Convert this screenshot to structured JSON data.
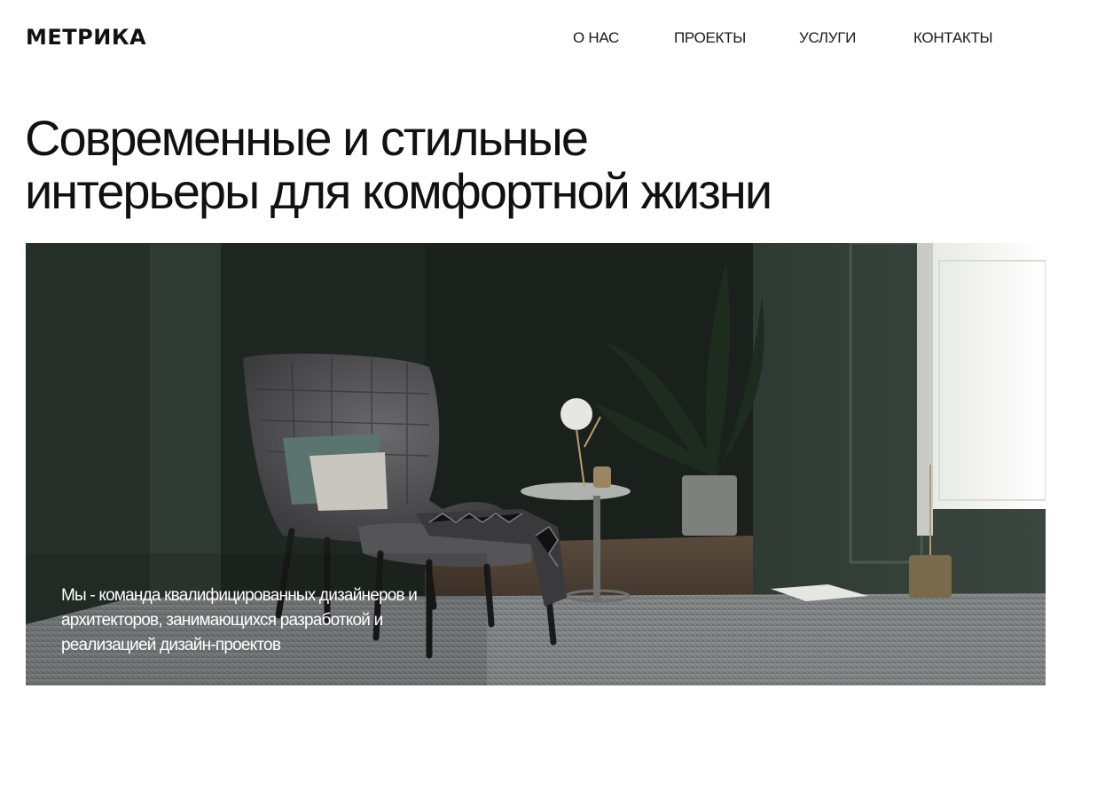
{
  "brand": {
    "logo": "МЕТРИКА"
  },
  "nav": {
    "items": [
      {
        "label": "О НАС"
      },
      {
        "label": "ПРОЕКТЫ"
      },
      {
        "label": "УСЛУГИ"
      },
      {
        "label": "КОНТАКТЫ"
      }
    ]
  },
  "hero": {
    "headline_line1": "Современные и стильные",
    "headline_line2": "интерьеры для комфортной жизни",
    "caption": "Мы - команда квалифицированных дизайнеров и архитекторов, занимающихся разработкой и реализацией дизайн-проектов"
  }
}
